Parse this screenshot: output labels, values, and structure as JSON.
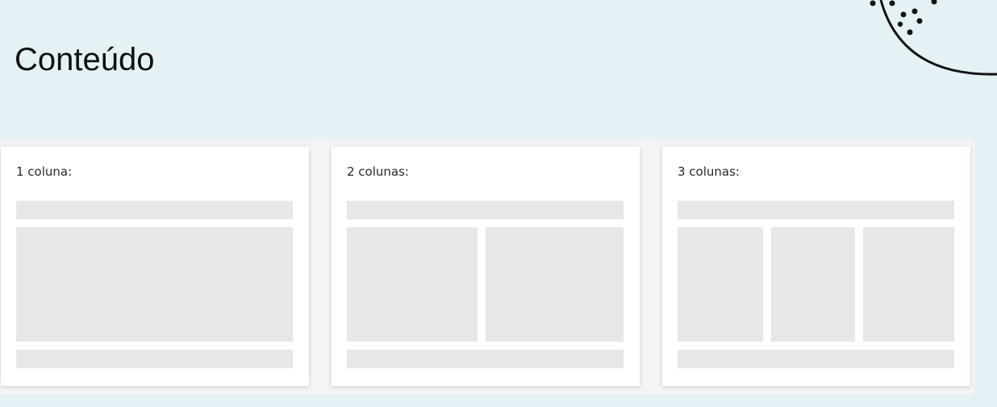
{
  "page": {
    "title": "Conteúdo"
  },
  "decoration": {
    "icon": "dotted-arc-decoration"
  },
  "layouts": [
    {
      "label": "1 coluna:",
      "columns": 1
    },
    {
      "label": "2 colunas:",
      "columns": 2
    },
    {
      "label": "3 colunas:",
      "columns": 3
    }
  ],
  "colors": {
    "background": "#e5f2f5",
    "card": "#ffffff",
    "placeholder": "#e7e7ea",
    "text": "#111111"
  }
}
